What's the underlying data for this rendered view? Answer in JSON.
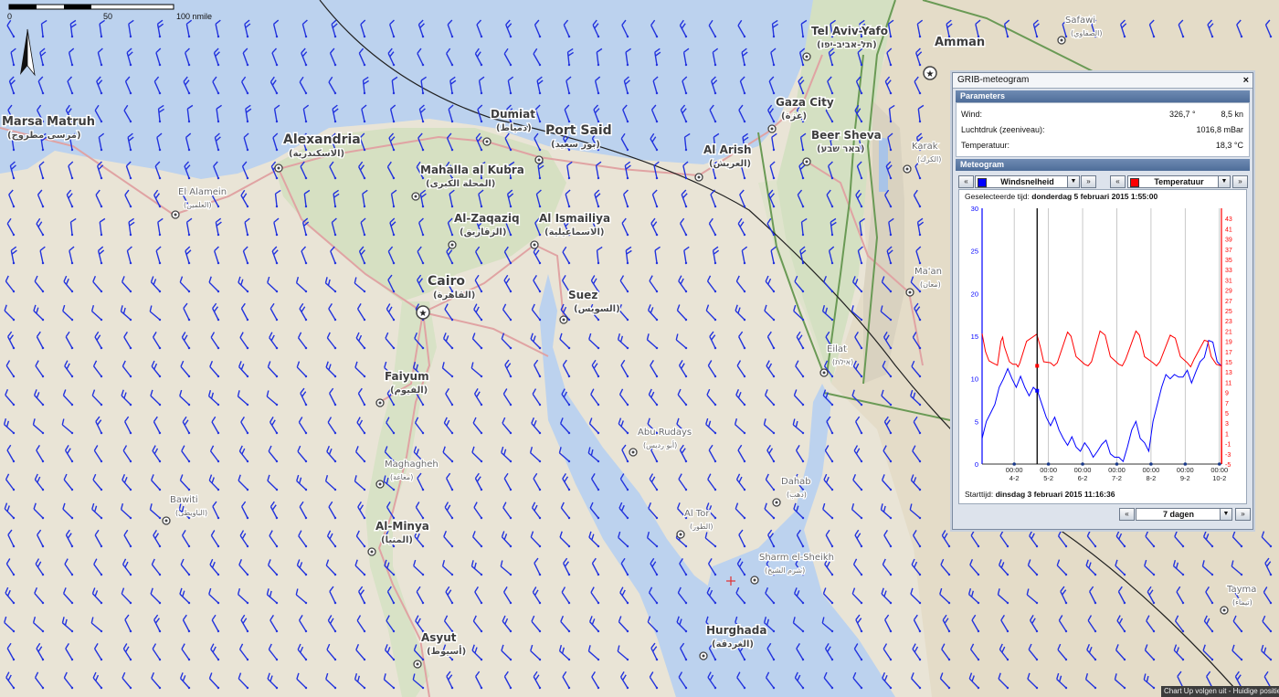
{
  "scale_bar": {
    "ticks": [
      "0",
      "50",
      "100 nmile"
    ]
  },
  "map": {
    "cities": [
      {
        "name": "Marsa Matruh",
        "arabic": "(مرسى مطروح)"
      },
      {
        "name": "Alexandria",
        "arabic": "(الاسكندرية)"
      },
      {
        "name": "El Alamein",
        "arabic": "(العلمين)"
      },
      {
        "name": "Dumiat",
        "arabic": "(دمياط)"
      },
      {
        "name": "Port Said",
        "arabic": "(بور سعيد)"
      },
      {
        "name": "Mahalla al Kubra",
        "arabic": "(المحلة الكبرى)"
      },
      {
        "name": "Al-Zaqaziq",
        "arabic": "(الزقازيق)"
      },
      {
        "name": "Al Ismailiya",
        "arabic": "(الاسماعيلية)"
      },
      {
        "name": "Cairo",
        "arabic": "(القاهرة)"
      },
      {
        "name": "Suez",
        "arabic": "(السويس)"
      },
      {
        "name": "Faiyum",
        "arabic": "(الفيوم)"
      },
      {
        "name": "Maghagheh",
        "arabic": "(مغاغة)"
      },
      {
        "name": "Bawiti",
        "arabic": "(الباويطى)"
      },
      {
        "name": "Al-Minya",
        "arabic": "(المنيا)"
      },
      {
        "name": "Asyut",
        "arabic": "(أسيوط)"
      },
      {
        "name": "Abu Rudays",
        "arabic": "(أبو رديس)"
      },
      {
        "name": "Al Tor",
        "arabic": "(الطور)"
      },
      {
        "name": "Sharm el-Sheikh",
        "arabic": "(شرم الشيخ)"
      },
      {
        "name": "Dahab",
        "arabic": "(دهب)"
      },
      {
        "name": "Hurghada",
        "arabic": "(الغردقة)"
      },
      {
        "name": "Al Arish",
        "arabic": "(العريش)"
      },
      {
        "name": "Gaza City",
        "arabic": "(غزة)"
      },
      {
        "name": "Tel Aviv-Yafo",
        "arabic": "(תל-אביב-יפו)"
      },
      {
        "name": "Beer Sheva",
        "arabic": "(באר שבע)"
      },
      {
        "name": "Eilat",
        "arabic": "(אילת)"
      },
      {
        "name": "Amman",
        "arabic": ""
      },
      {
        "name": "Karak",
        "arabic": "(الكرك)"
      },
      {
        "name": "Ma'an",
        "arabic": "(معان)"
      },
      {
        "name": "Safawi",
        "arabic": "(الصفاوي)"
      },
      {
        "name": "Tayma",
        "arabic": "(تيماء)"
      }
    ]
  },
  "panel": {
    "title": "GRIB-meteogram",
    "close_glyph": "×",
    "parameters_header": "Parameters",
    "params": [
      {
        "label": "Wind:",
        "value": "326,7 °",
        "unit": "8,5 kn"
      },
      {
        "label": "Luchtdruk (zeeniveau):",
        "value": "",
        "unit": "1016,8 mBar"
      },
      {
        "label": "Temperatuur:",
        "value": "",
        "unit": "18,3 °C"
      }
    ],
    "meteogram_header": "Meteogram",
    "left_select": "Windsnelheid",
    "right_select": "Temperatuur",
    "left_color": "#0000ff",
    "right_color": "#ff0000",
    "selected_time_label": "Geselecteerde tijd:",
    "selected_time_value": "donderdag 5 februari 2015 1:55:00",
    "start_time_label": "Starttijd:",
    "start_time_value": "dinsdag 3 februari 2015 11:16:36",
    "range_select": "7 dagen",
    "prev_glyph": "«",
    "next_glyph": "»",
    "dd_glyph": "▼"
  },
  "chart_data": {
    "type": "line",
    "x_ticks": [
      "00:00\n4-2",
      "00:00\n5-2",
      "00:00\n6-2",
      "00:00\n7-2",
      "00:00\n8-2",
      "00:00\n9-2",
      "00:00\n10-2"
    ],
    "x_range_days": [
      0,
      7
    ],
    "left_axis": {
      "label": "Windsnelheid",
      "ylim": [
        0,
        30
      ],
      "ticks": [
        0,
        5,
        10,
        15,
        20,
        25,
        30
      ],
      "color": "#0000ff"
    },
    "right_axis": {
      "label": "Temperatuur",
      "ylim": [
        -5,
        45
      ],
      "ticks": [
        -5,
        -3,
        -1,
        1,
        3,
        5,
        7,
        9,
        11,
        13,
        15,
        17,
        19,
        21,
        23,
        25,
        27,
        29,
        31,
        33,
        35,
        37,
        39,
        41,
        43
      ],
      "color": "#ff0000"
    },
    "series": [
      {
        "name": "Windsnelheid",
        "axis": "left",
        "x": [
          0,
          0.125,
          0.25,
          0.375,
          0.5,
          0.625,
          0.75,
          0.875,
          1,
          1.125,
          1.25,
          1.375,
          1.5,
          1.625,
          1.75,
          1.875,
          2,
          2.125,
          2.25,
          2.375,
          2.5,
          2.625,
          2.75,
          2.875,
          3,
          3.125,
          3.25,
          3.375,
          3.5,
          3.625,
          3.75,
          3.875,
          4,
          4.125,
          4.25,
          4.375,
          4.5,
          4.625,
          4.75,
          4.875,
          5,
          5.125,
          5.25,
          5.375,
          5.5,
          5.625,
          5.75,
          5.875,
          6,
          6.125,
          6.25,
          6.375,
          6.5,
          6.625,
          6.75,
          6.875,
          7
        ],
        "values": [
          3,
          5,
          6,
          7,
          9,
          10,
          11.2,
          10,
          9,
          10.3,
          9,
          8,
          9,
          8.5,
          7,
          5.5,
          4.5,
          5.5,
          4,
          3,
          2.2,
          3.2,
          2,
          1.5,
          2.5,
          1.8,
          0.8,
          1.5,
          2.3,
          2.8,
          1.2,
          0.8,
          0.8,
          0.3,
          2,
          4,
          5,
          3,
          2.5,
          1.5,
          5,
          7,
          9,
          10.5,
          10,
          10.5,
          10.2,
          10.2,
          11,
          9.5,
          10.8,
          12,
          12.5,
          14.5,
          14.3,
          12,
          11.5
        ]
      },
      {
        "name": "Temperatuur",
        "axis": "right",
        "x": [
          0,
          0.1,
          0.2,
          0.3,
          0.45,
          0.55,
          0.6,
          0.65,
          0.8,
          0.9,
          1,
          1.05,
          1.1,
          1.3,
          1.6,
          1.7,
          1.8,
          2,
          2.1,
          2.2,
          2.5,
          2.6,
          2.75,
          3,
          3.1,
          3.2,
          3.45,
          3.6,
          3.75,
          4,
          4.1,
          4.2,
          4.5,
          4.6,
          4.75,
          5,
          5.1,
          5.2,
          5.5,
          5.65,
          5.8,
          6,
          6.1,
          6.2,
          6.5,
          6.6,
          6.7,
          6.85,
          7,
          7.01
        ],
        "values": [
          20.5,
          17,
          15.2,
          14.8,
          14.3,
          19,
          19.8,
          18,
          15,
          14.5,
          14.5,
          14,
          14.7,
          19,
          20.4,
          18,
          15,
          14.8,
          14.2,
          14.8,
          20.8,
          20,
          16,
          14.5,
          14.2,
          15,
          21,
          20.2,
          16,
          14.5,
          14.2,
          15.5,
          21,
          20.2,
          16,
          14.8,
          14.2,
          15,
          20.2,
          19.6,
          16,
          14.8,
          14,
          15.5,
          19.2,
          19,
          16,
          14.5,
          14.2,
          -5
        ]
      }
    ],
    "selected_x": 1.61,
    "grid": true
  },
  "status_bar": "Chart Up volgen uit - Huidige positie"
}
